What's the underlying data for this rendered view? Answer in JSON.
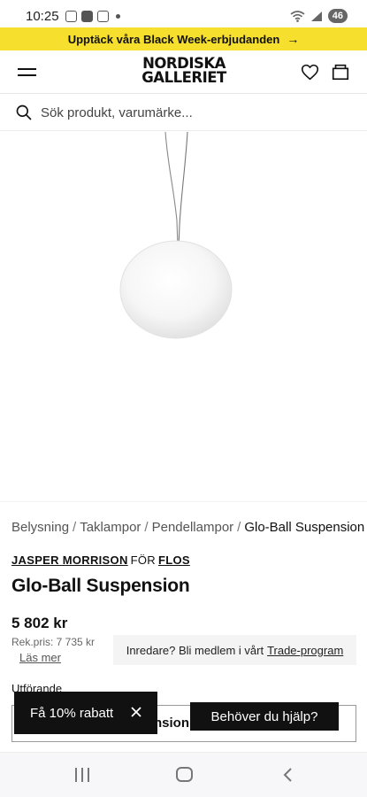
{
  "status_bar": {
    "time": "10:25",
    "battery": "46",
    "icons": [
      "screenshot-icon",
      "gallery-icon",
      "video-call-icon",
      "wifi-icon",
      "signal-icon",
      "battery-icon"
    ]
  },
  "promo": {
    "text": "Upptäck våra Black Week-erbjudanden",
    "arrow": "→",
    "background": "#f6df2d"
  },
  "header": {
    "logo_line1": "NORDISKA",
    "logo_line2": "GALLERIET",
    "icons": [
      "menu-icon",
      "heart-icon",
      "cart-icon"
    ]
  },
  "search": {
    "placeholder": "Sök produkt, varumärke..."
  },
  "breadcrumb": {
    "items": [
      "Belysning",
      "Taklampor",
      "Pendellampor"
    ],
    "current": "Glo-Ball Suspension",
    "separator": "/"
  },
  "product": {
    "designer": "JASPER MORRISON",
    "for_text": "FÖR",
    "brand": "FLOS",
    "title": "Glo-Ball Suspension",
    "price": "5 802 kr",
    "rek_price": "Rek.pris: 7 735 kr",
    "read_more": "Läs mer",
    "trade_text": "Inredare? Bli medlem i vårt",
    "trade_link": "Trade-program",
    "variant_label": "Utförande",
    "variant_value": "nsion 2"
  },
  "popups": {
    "discount": "Få 10% rabatt",
    "help": "Behöver du hjälp?"
  },
  "nav_bar": {
    "icons": [
      "recents-icon",
      "home-icon",
      "back-icon"
    ]
  }
}
